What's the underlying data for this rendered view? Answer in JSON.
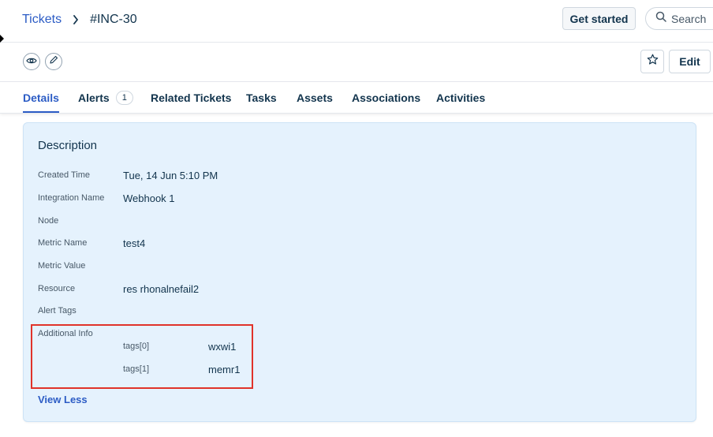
{
  "header": {
    "breadcrumb_root": "Tickets",
    "breadcrumb_current": "#INC-30",
    "get_started_label": "Get started",
    "search_label": "Search"
  },
  "toolbar": {
    "watch_icon": "eye-icon",
    "edit_icon": "pencil-icon",
    "favorite_icon": "star-icon",
    "edit_label": "Edit"
  },
  "tabs": [
    {
      "label": "Details",
      "active": true
    },
    {
      "label": "Alerts",
      "count": "1"
    },
    {
      "label": "Related Tickets"
    },
    {
      "label": "Tasks"
    },
    {
      "label": "Assets"
    },
    {
      "label": "Associations"
    },
    {
      "label": "Activities"
    }
  ],
  "description": {
    "title": "Description",
    "fields": [
      {
        "label": "Created Time",
        "value": "Tue, 14 Jun 5:10 PM"
      },
      {
        "label": "Integration Name",
        "value": "Webhook 1"
      },
      {
        "label": "Node",
        "value": ""
      },
      {
        "label": "Metric Name",
        "value": "test4"
      },
      {
        "label": "Metric Value",
        "value": ""
      },
      {
        "label": "Resource",
        "value": "res rhonalnefail2"
      },
      {
        "label": "Alert Tags",
        "value": ""
      }
    ],
    "additional_info": {
      "label": "Additional Info",
      "items": [
        {
          "key": "tags[0]",
          "value": "wxwi1"
        },
        {
          "key": "tags[1]",
          "value": "memr1"
        }
      ]
    },
    "view_less_label": "View Less"
  },
  "colors": {
    "accent": "#2c5cc5",
    "card_background": "#e5f2fd",
    "highlight": "#e0332a"
  }
}
